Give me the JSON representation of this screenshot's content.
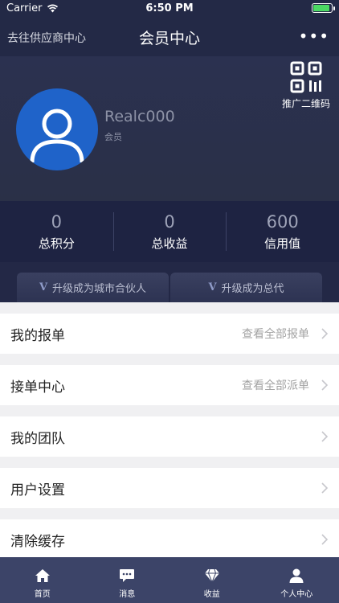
{
  "status_bar": {
    "carrier": "Carrier",
    "time": "6:50 PM",
    "battery_level": 0.9
  },
  "nav": {
    "left_link": "去往供应商中心",
    "title": "会员中心",
    "more": "•••"
  },
  "profile": {
    "username": "Realc000",
    "role": "会员",
    "qr_label": "推广二维码"
  },
  "stats": [
    {
      "value": "0",
      "label": "总积分"
    },
    {
      "value": "0",
      "label": "总收益"
    },
    {
      "value": "600",
      "label": "信用值"
    }
  ],
  "upgrades": [
    {
      "icon": "V",
      "label": "升级成为城市合伙人"
    },
    {
      "icon": "V",
      "label": "升级成为总代"
    }
  ],
  "menu": [
    {
      "label": "我的报单",
      "hint": "查看全部报单"
    },
    {
      "label": "接单中心",
      "hint": "查看全部派单"
    },
    {
      "label": "我的团队",
      "hint": ""
    },
    {
      "label": "用户设置",
      "hint": ""
    },
    {
      "label": "清除缓存",
      "hint": ""
    }
  ],
  "tabbar": [
    {
      "label": "首页",
      "icon": "home-icon"
    },
    {
      "label": "消息",
      "icon": "message-icon"
    },
    {
      "label": "收益",
      "icon": "diamond-icon"
    },
    {
      "label": "个人中心",
      "icon": "person-icon"
    }
  ]
}
